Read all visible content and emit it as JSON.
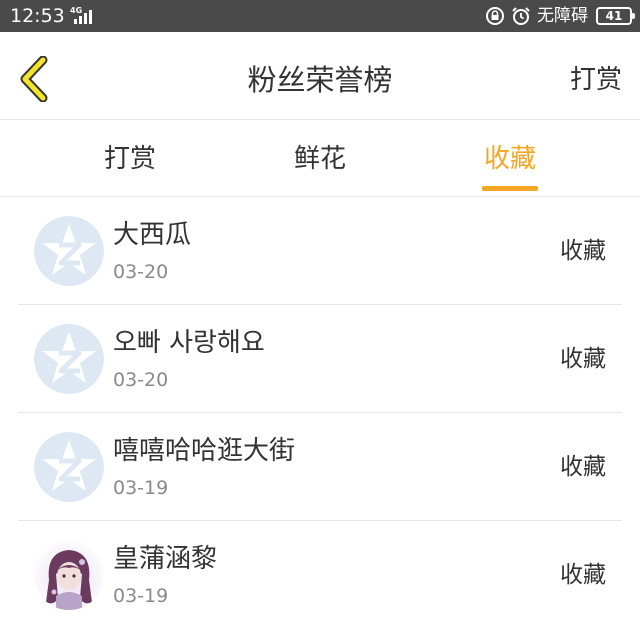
{
  "status_bar": {
    "time": "12:53",
    "network": "4G",
    "accessibility": "无障碍",
    "battery": "41"
  },
  "header": {
    "title": "粉丝荣誉榜",
    "action": "打赏",
    "back_icon": "chevron-left-icon"
  },
  "tabs": [
    {
      "label": "打赏",
      "active": false
    },
    {
      "label": "鲜花",
      "active": false
    },
    {
      "label": "收藏",
      "active": true
    }
  ],
  "list": [
    {
      "name": "大西瓜",
      "date": "03-20",
      "action": "收藏",
      "avatar": "default-qq-avatar-icon"
    },
    {
      "name": "오빠 사랑해요",
      "date": "03-20",
      "action": "收藏",
      "avatar": "default-qq-avatar-icon"
    },
    {
      "name": "嘻嘻哈哈逛大街",
      "date": "03-19",
      "action": "收藏",
      "avatar": "default-qq-avatar-icon"
    },
    {
      "name": "皇蒲涵黎",
      "date": "03-19",
      "action": "收藏",
      "avatar": "user-photo-avatar"
    }
  ],
  "colors": {
    "accent": "#f5a623",
    "status_bar": "#4a4a4a",
    "text": "#333333",
    "subtext": "#8a8a8a",
    "divider": "#e6e6e6",
    "default_avatar_bg": "#dde8f3"
  }
}
